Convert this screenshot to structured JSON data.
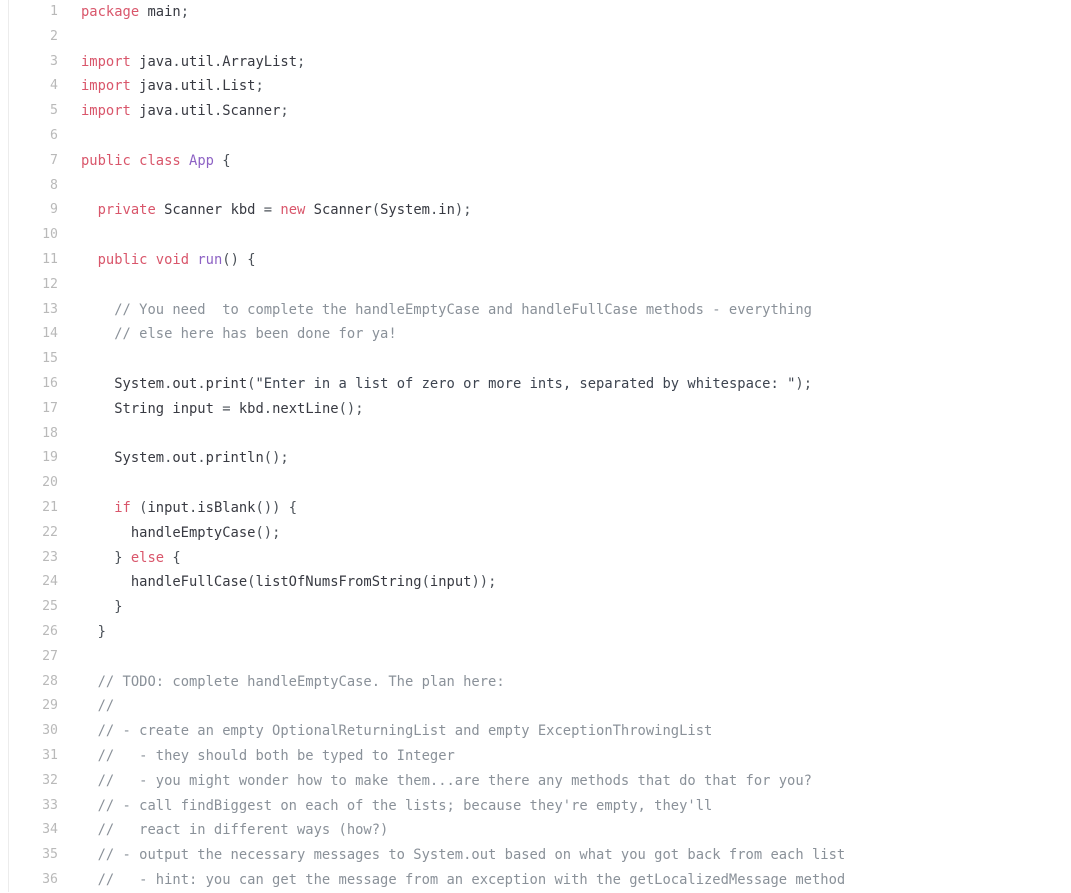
{
  "editor": {
    "language": "java",
    "background": "#ffffff",
    "gutter_color": "#b9b9b9",
    "colors": {
      "keyword": "#d9566b",
      "identifier": "#383a42",
      "type": "#8d62c4",
      "function": "#8d62c4",
      "string": "#3d4450",
      "comment": "#8a9199",
      "punctuation": "#4b5158"
    },
    "first_line": 1,
    "last_line": 36
  },
  "lines": [
    {
      "num": "1",
      "text": "package main;"
    },
    {
      "num": "2",
      "text": ""
    },
    {
      "num": "3",
      "text": "import java.util.ArrayList;"
    },
    {
      "num": "4",
      "text": "import java.util.List;"
    },
    {
      "num": "5",
      "text": "import java.util.Scanner;"
    },
    {
      "num": "6",
      "text": ""
    },
    {
      "num": "7",
      "text": "public class App {"
    },
    {
      "num": "8",
      "text": ""
    },
    {
      "num": "9",
      "text": "  private Scanner kbd = new Scanner(System.in);"
    },
    {
      "num": "10",
      "text": ""
    },
    {
      "num": "11",
      "text": "  public void run() {"
    },
    {
      "num": "12",
      "text": ""
    },
    {
      "num": "13",
      "text": "    // You need  to complete the handleEmptyCase and handleFullCase methods - everything"
    },
    {
      "num": "14",
      "text": "    // else here has been done for ya!"
    },
    {
      "num": "15",
      "text": ""
    },
    {
      "num": "16",
      "text": "    System.out.print(\"Enter in a list of zero or more ints, separated by whitespace: \");"
    },
    {
      "num": "17",
      "text": "    String input = kbd.nextLine();"
    },
    {
      "num": "18",
      "text": ""
    },
    {
      "num": "19",
      "text": "    System.out.println();"
    },
    {
      "num": "20",
      "text": ""
    },
    {
      "num": "21",
      "text": "    if (input.isBlank()) {"
    },
    {
      "num": "22",
      "text": "      handleEmptyCase();"
    },
    {
      "num": "23",
      "text": "    } else {"
    },
    {
      "num": "24",
      "text": "      handleFullCase(listOfNumsFromString(input));"
    },
    {
      "num": "25",
      "text": "    }"
    },
    {
      "num": "26",
      "text": "  }"
    },
    {
      "num": "27",
      "text": ""
    },
    {
      "num": "28",
      "text": "  // TODO: complete handleEmptyCase. The plan here:"
    },
    {
      "num": "29",
      "text": "  //"
    },
    {
      "num": "30",
      "text": "  // - create an empty OptionalReturningList and empty ExceptionThrowingList"
    },
    {
      "num": "31",
      "text": "  //   - they should both be typed to Integer"
    },
    {
      "num": "32",
      "text": "  //   - you might wonder how to make them...are there any methods that do that for you?"
    },
    {
      "num": "33",
      "text": "  // - call findBiggest on each of the lists; because they're empty, they'll"
    },
    {
      "num": "34",
      "text": "  //   react in different ways (how?)"
    },
    {
      "num": "35",
      "text": "  // - output the necessary messages to System.out based on what you got back from each list"
    },
    {
      "num": "36",
      "text": "  //   - hint: you can get the message from an exception with the getLocalizedMessage method"
    }
  ],
  "tokens": {
    "keywords": [
      "package",
      "import",
      "public",
      "class",
      "private",
      "new",
      "void",
      "if",
      "else"
    ],
    "types": [
      "App"
    ],
    "functions": [
      "run"
    ]
  }
}
